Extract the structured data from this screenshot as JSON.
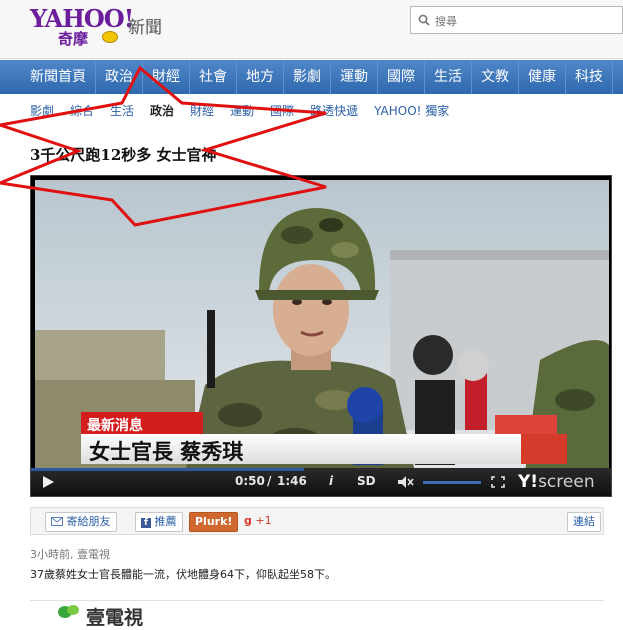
{
  "header": {
    "logo_main": "YAHOO!",
    "logo_sub": "奇摩",
    "section_title": "新聞",
    "search_placeholder": "搜尋"
  },
  "nav": {
    "items": [
      "新聞首頁",
      "政治",
      "財經",
      "社會",
      "地方",
      "影劇",
      "運動",
      "國際",
      "生活",
      "文教",
      "健康",
      "科技"
    ]
  },
  "subnav": {
    "items": [
      "影劇",
      "綜合",
      "生活",
      "政治",
      "財經",
      "運動",
      "國際",
      "路透快遞",
      "YAHOO! 獨家"
    ],
    "active": "政治"
  },
  "article": {
    "title": "3千公尺跑12秒多 女士官神",
    "meta": "3小時前, 壹電視",
    "summary": "37歲蔡姓女士官長體能一流，伏地體身64下，仰臥起坐58下。"
  },
  "video": {
    "breaking_label": "最新消息",
    "caption": "女士官長 蔡秀琪",
    "current_time": "0:50",
    "separator": "/",
    "duration": "1:46",
    "info_symbol": "i",
    "quality_label": "SD",
    "brand_logo": "Y!",
    "brand_name": "screen",
    "progress": 0.47
  },
  "share": {
    "email": "寄給朋友",
    "facebook": "推薦",
    "plurk": "Plurk!",
    "gplus": "+1",
    "link": "連結"
  },
  "footer": {
    "channel_label": "壹電視"
  },
  "colors": {
    "brand_purple": "#6b1d9c",
    "nav_blue": "#2f68ad",
    "link_blue": "#2b5fa6",
    "breaking_red": "#d41e1e",
    "annotation_red": "#e01010"
  }
}
